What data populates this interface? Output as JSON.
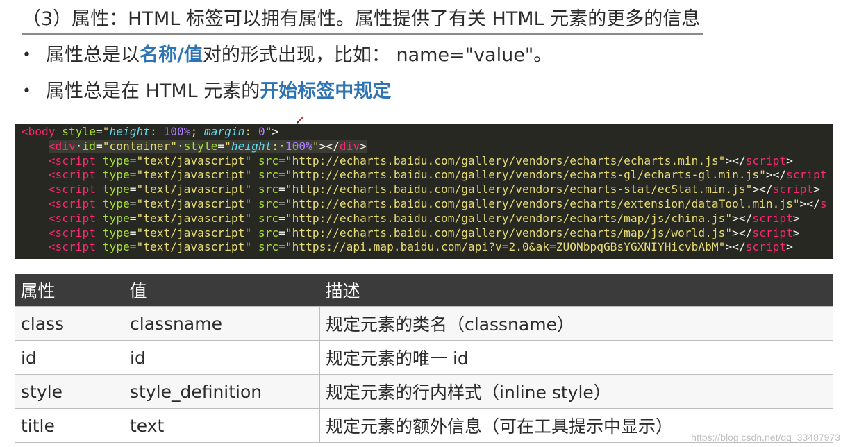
{
  "heading": "（3）属性：HTML 标签可以拥有属性。属性提供了有关 HTML 元素的更多的信息",
  "bullets": [
    {
      "prefix": "属性总是以",
      "highlight": "名称/值",
      "suffix": "对的形式出现，比如： name=\"value\"。"
    },
    {
      "prefix": "属性总是在 HTML 元素的",
      "highlight": "开始标签中规定",
      "suffix": ""
    }
  ],
  "code": {
    "body_open": {
      "lt": "<",
      "tag": "body",
      "attr": "style",
      "eq": "=",
      "q1": "\"",
      "p1": "height",
      "p1sep": ": ",
      "v1": "100%",
      "semi": "; ",
      "p2": "margin",
      "p2sep": ": ",
      "v2": "0",
      "q2": "\"",
      "gt": ">"
    },
    "div_line": {
      "lt": "<",
      "tag": "div",
      "sp1": "·",
      "attr1": "id",
      "eq1": "=",
      "val1": "\"container\"",
      "sp2": "·",
      "attr2": "style",
      "eq2": "=",
      "q1": "\"",
      "prop": "height",
      "sep": ":·",
      "num": "100%",
      "q2": "\"",
      "gt": "></",
      "ctag": "div",
      "cgt": ">"
    },
    "script_lines": [
      {
        "lt": "<",
        "tag": "script",
        "type_attr": "type",
        "eq": "=",
        "type_val": "\"text/javascript\"",
        "src_attr": "src",
        "src_val": "\"http://echarts.baidu.com/gallery/vendors/echarts/echarts.min.js\"",
        "close": "></",
        "ctag": "script",
        "cgt": ">"
      },
      {
        "lt": "<",
        "tag": "script",
        "type_attr": "type",
        "eq": "=",
        "type_val": "\"text/javascript\"",
        "src_attr": "src",
        "src_val": "\"http://echarts.baidu.com/gallery/vendors/echarts-gl/echarts-gl.min.js\"",
        "close": "></",
        "ctag": "script",
        "cgt": ""
      },
      {
        "lt": "<",
        "tag": "script",
        "type_attr": "type",
        "eq": "=",
        "type_val": "\"text/javascript\"",
        "src_attr": "src",
        "src_val": "\"http://echarts.baidu.com/gallery/vendors/echarts-stat/ecStat.min.js\"",
        "close": "></",
        "ctag": "script",
        "cgt": ">"
      },
      {
        "lt": "<",
        "tag": "script",
        "type_attr": "type",
        "eq": "=",
        "type_val": "\"text/javascript\"",
        "src_attr": "src",
        "src_val": "\"http://echarts.baidu.com/gallery/vendors/echarts/extension/dataTool.min.js\"",
        "close": "></",
        "ctag": "s",
        "cgt": ""
      },
      {
        "lt": "<",
        "tag": "script",
        "type_attr": "type",
        "eq": "=",
        "type_val": "\"text/javascript\"",
        "src_attr": "src",
        "src_val": "\"http://echarts.baidu.com/gallery/vendors/echarts/map/js/china.js\"",
        "close": "></",
        "ctag": "script",
        "cgt": ">"
      },
      {
        "lt": "<",
        "tag": "script",
        "type_attr": "type",
        "eq": "=",
        "type_val": "\"text/javascript\"",
        "src_attr": "src",
        "src_val": "\"http://echarts.baidu.com/gallery/vendors/echarts/map/js/world.js\"",
        "close": "></",
        "ctag": "script",
        "cgt": ">"
      },
      {
        "lt": "<",
        "tag": "script",
        "type_attr": "type",
        "eq": "=",
        "type_val": "\"text/javascript\"",
        "src_attr": "src",
        "src_val": "\"https://api.map.baidu.com/api?v=2.0&ak=ZUONbpqGBsYGXNIYHicvbAbM\"",
        "close": "></",
        "ctag": "script",
        "cgt": ">"
      }
    ]
  },
  "table": {
    "headers": [
      "属性",
      "值",
      "描述"
    ],
    "rows": [
      [
        "class",
        "classname",
        "规定元素的类名（classname）"
      ],
      [
        "id",
        "id",
        "规定元素的唯一 id"
      ],
      [
        "style",
        "style_definition",
        "规定元素的行内样式（inline style）"
      ],
      [
        "title",
        "text",
        "规定元素的额外信息（可在工具提示中显示）"
      ]
    ]
  },
  "watermark": "https://blog.csdn.net/qq_33487973",
  "colors": {
    "highlight": "#2e74b5",
    "code_bg": "#272822",
    "table_header_bg": "#3b3b3b"
  }
}
